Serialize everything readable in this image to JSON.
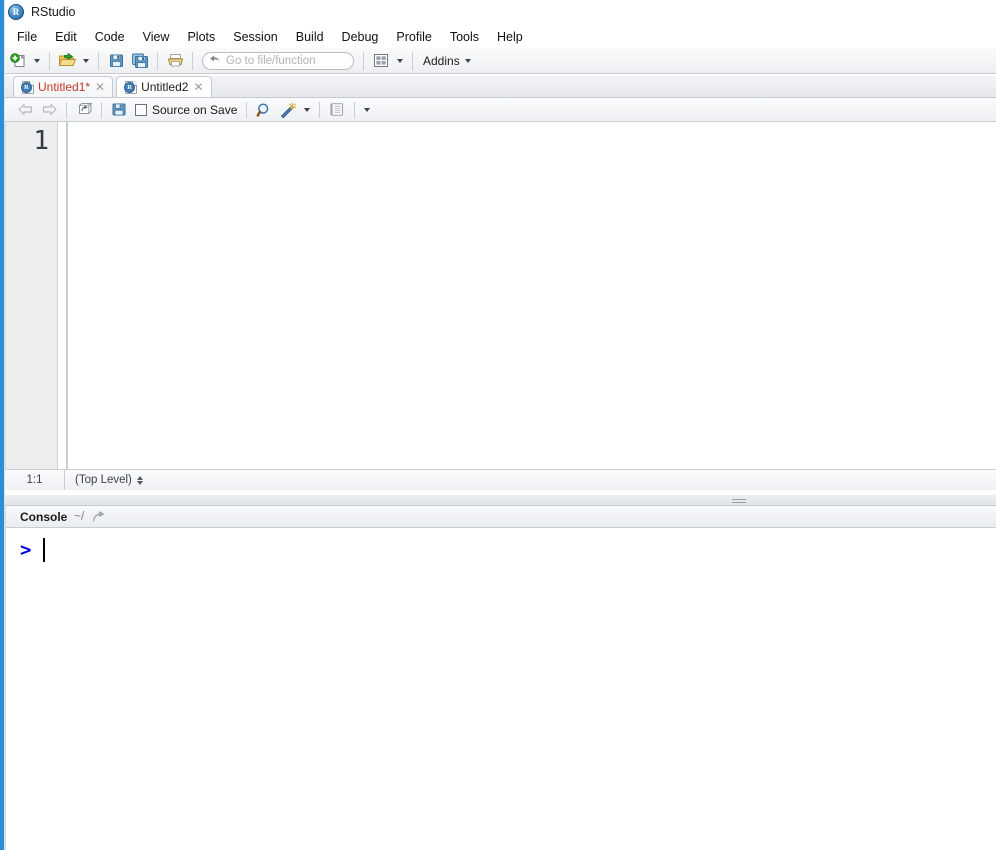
{
  "window": {
    "title": "RStudio",
    "app_icon": "rstudio-logo-icon",
    "accent_color": "#2a8fd6"
  },
  "menubar": {
    "items": [
      {
        "label": "File"
      },
      {
        "label": "Edit"
      },
      {
        "label": "Code"
      },
      {
        "label": "View"
      },
      {
        "label": "Plots"
      },
      {
        "label": "Session"
      },
      {
        "label": "Build"
      },
      {
        "label": "Debug"
      },
      {
        "label": "Profile"
      },
      {
        "label": "Tools"
      },
      {
        "label": "Help"
      }
    ]
  },
  "toolbar": {
    "new_file_icon": "new-document-icon",
    "new_file_dropdown_icon": "chevron-down-icon",
    "open_file_icon": "open-folder-icon",
    "open_file_dropdown_icon": "chevron-down-icon",
    "save_icon": "save-floppy-icon",
    "save_all_icon": "save-all-icon",
    "print_icon": "printer-icon",
    "goto_search_icon": "goto-arrow-icon",
    "goto_placeholder": "Go to file/function",
    "goto_value": "",
    "workspace_panes_icon": "pane-layout-icon",
    "workspace_panes_dropdown_icon": "chevron-down-icon",
    "addins_label": "Addins",
    "addins_dropdown_icon": "chevron-down-icon"
  },
  "source": {
    "tabs": [
      {
        "label": "Untitled1*",
        "icon": "r-script-icon",
        "close_icon": "close-icon",
        "active": false,
        "modified": true
      },
      {
        "label": "Untitled2",
        "icon": "r-script-icon",
        "close_icon": "close-icon",
        "active": true,
        "modified": false
      }
    ],
    "editor_toolbar": {
      "back_icon": "arrow-left-icon",
      "forward_icon": "arrow-right-icon",
      "show_in_new_window_icon": "popout-window-icon",
      "save_icon": "save-floppy-icon",
      "source_on_save_checkbox": "checkbox-unchecked",
      "source_on_save_label": "Source on Save",
      "find_icon": "magnifier-icon",
      "code_tools_icon": "magic-wand-icon",
      "code_tools_dropdown_icon": "chevron-down-icon",
      "compile_report_icon": "notebook-icon",
      "source_dropdown_icon": "chevron-down-icon"
    },
    "gutter": {
      "line_numbers": [
        "1"
      ]
    },
    "content": "",
    "status": {
      "cursor_position": "1:1",
      "scope": "(Top Level)",
      "scope_spinner_icon": "updown-spinner-icon"
    }
  },
  "splitter": {
    "grip_icon": "resize-grip-icon"
  },
  "console": {
    "title": "Console",
    "working_directory": "~/",
    "popout_icon": "popout-arrow-icon",
    "prompt": ">",
    "input_value": "",
    "prompt_color": "#0000e6"
  }
}
